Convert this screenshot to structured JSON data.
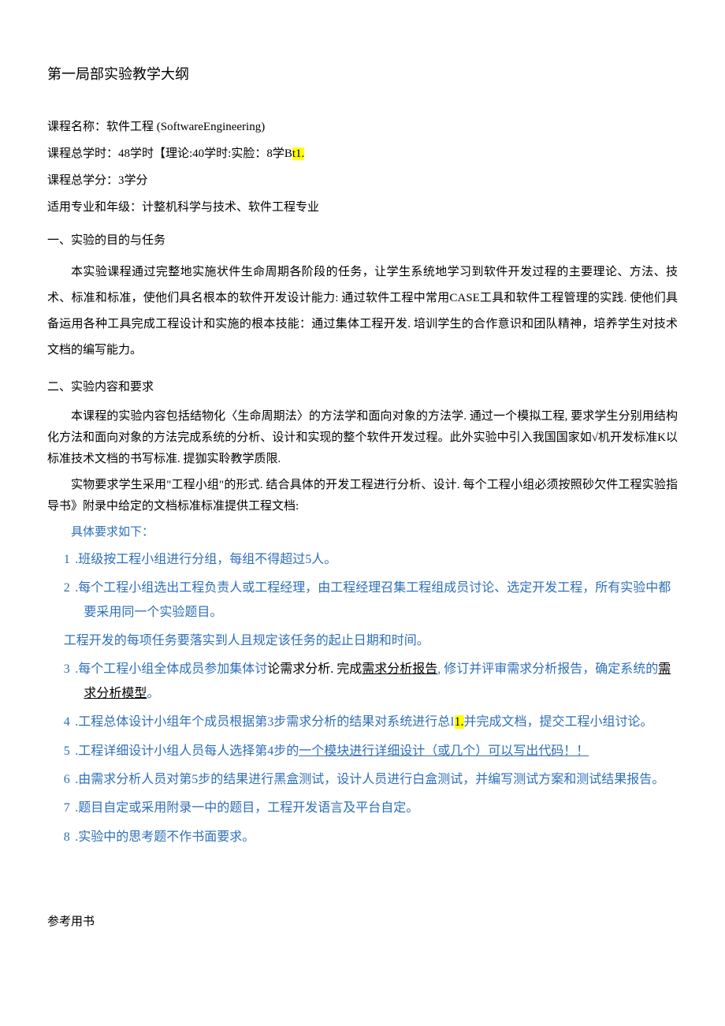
{
  "title": "第一局部实验教学大纲",
  "meta": {
    "course_name_label": "课程名称：",
    "course_name": "软件工程 (SoftwareEngineering)",
    "hours_label": "课程总学时：",
    "hours_value": "48学时【理论:40学时:实脸：8学B",
    "hours_highlight": "t1.",
    "credits_label": "课程总学分：",
    "credits_value": "3学分",
    "major_label": "适用专业和年级：",
    "major_value": "计整机科学与技术、软件工程专业"
  },
  "section1": {
    "heading": "一、实验的目的与任务",
    "p1": "本实验课程通过完整地实施状件生命周期各阶段的任务，让学生系统地学习到软件开发过程的主要理论、方法、技术、标准和标准，使他们具名根本的软件开发设计能力: 通过软件工程中常用CASE工具和软件工程管理的实践. 使他们具备运用各种工具完成工程设计和实施的根本技能：通过集体工程开发. 培训学生的合作意识和团队精神，培养学生对技术文档的编写能力。"
  },
  "section2": {
    "heading": "二、实验内容和要求",
    "p1": "本课程的实验内容包括结物化〈生命周期法〉的方法学和面向对象的方法学. 通过一个模拟工程, 要求学生分别用结构化方法和面向对象的方法完成系统的分析、设计和实现的整个软件开发过程。此外实验中引入我国国家如√机开发标准K以标准技术文档的书写标准. 提㹢实聆教学质限.",
    "p2": "实物要求学生采用\"工程小组\"的形式. 结合具体的开发工程进行分析、设计. 每个工程小组必须按照砂欠件工程实验指导书》附录中给定的文档标准标准提供工程文档:",
    "req_intro": "具体要求如下：",
    "items": {
      "n1": "1",
      "t1": ".班级按工程小组进行分组，每组不得超过5人。",
      "n2": "2",
      "t2": ".每个工程小组选出工程负责人或工程经理，由工程经理召集工程组成员讨论、选定开发工程，所有实验中都要采用同一个实验题目。",
      "t2b": "工程开发的每项任务要落实到人且规定该任务的起止日期和时间。",
      "n3": "3",
      "t3a": ".每个工程小组全体成员参加集体讨",
      "t3b": "论需求分析. 完成",
      "t3c": "需求分析报告",
      "t3d": ", 修订并评审需求分析报告，确定系统的",
      "t3e": "需求分析模型",
      "t3f": "。",
      "n4": "4",
      "t4a": ".工程总体设计小组年个成员根据第3步需求分析的结果对系统进行总I",
      "t4hl": "1.",
      "t4b": "并完成文档，提交工程小组讨论。",
      "n5": "5",
      "t5a": ".工程详细设计小组人员每人选择第4步的",
      "t5b": "一个模块进行详细设计（或几个）可以写出代码！！",
      "n6": "6",
      "t6": ".由需求分析人员对第5步的结果进行黑盒测试，设计人员进行白盒测试，并编写测试方案和测试结果报告。",
      "n7": "7",
      "t7": ".题目自定或采用附录一中的题目，工程开发语言及平台自定。",
      "n8": "8",
      "t8": ".实验中的思考题不作书面要求。"
    }
  },
  "refs": "参考用书"
}
